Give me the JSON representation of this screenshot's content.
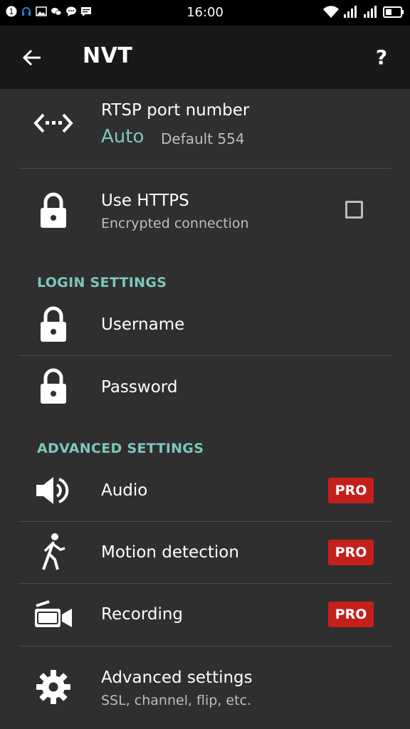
{
  "status_bar": {
    "time": "16:00",
    "badge": "1"
  },
  "app_bar": {
    "title": "NVT",
    "help_label": "?"
  },
  "rtsp": {
    "title": "RTSP port number",
    "value": "Auto",
    "default": "Default 554"
  },
  "https": {
    "title": "Use HTTPS",
    "subtitle": "Encrypted connection",
    "checked": false
  },
  "login_section": {
    "header": "LOGIN SETTINGS",
    "items": [
      {
        "label": "Username"
      },
      {
        "label": "Password"
      }
    ]
  },
  "advanced_section": {
    "header": "ADVANCED SETTINGS",
    "items": [
      {
        "label": "Audio",
        "badge": "PRO",
        "icon": "speaker-icon"
      },
      {
        "label": "Motion detection",
        "badge": "PRO",
        "icon": "walking-person-icon"
      },
      {
        "label": "Recording",
        "badge": "PRO",
        "icon": "video-camera-icon"
      }
    ]
  },
  "advanced_settings": {
    "title": "Advanced settings",
    "subtitle": "SSL, channel, flip, etc."
  },
  "colors": {
    "accent": "#7cc7bd",
    "pro_badge": "#c4201b",
    "background": "#2f2f2f",
    "app_bar": "#191919"
  }
}
